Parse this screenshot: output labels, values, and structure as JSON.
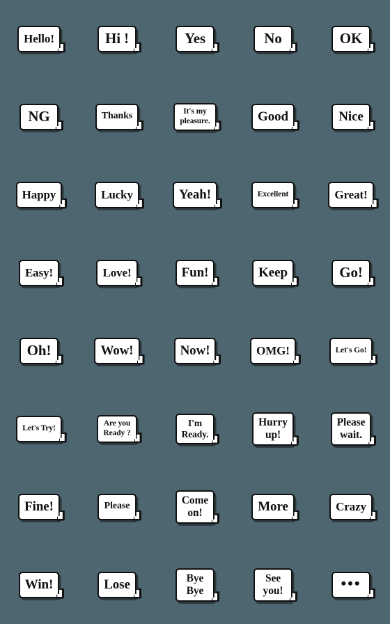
{
  "canvas": {
    "background_color": "#4d6670",
    "bubble_fill": "#ffffff",
    "bubble_border": "#111111",
    "text_color": "#111111",
    "columns": 5,
    "rows": 8
  },
  "stickers": [
    {
      "text": "Hello!",
      "size": "sz-md",
      "lines": 1
    },
    {
      "text": "Hi !",
      "size": "sz-xl",
      "lines": 1
    },
    {
      "text": "Yes",
      "size": "sz-xl",
      "lines": 1
    },
    {
      "text": "No",
      "size": "sz-xl",
      "lines": 1
    },
    {
      "text": "OK",
      "size": "sz-xl",
      "lines": 1
    },
    {
      "text": "NG",
      "size": "sz-xl",
      "lines": 1
    },
    {
      "text": "Thanks",
      "size": "sz-sm",
      "lines": 1
    },
    {
      "text": "It's my\npleasure.",
      "size": "sz-two-sm",
      "lines": 2
    },
    {
      "text": "Good",
      "size": "sz-lg",
      "lines": 1
    },
    {
      "text": "Nice",
      "size": "sz-lg",
      "lines": 1
    },
    {
      "text": "Happy",
      "size": "sz-md",
      "lines": 1
    },
    {
      "text": "Lucky",
      "size": "sz-md",
      "lines": 1
    },
    {
      "text": "Yeah!",
      "size": "sz-lg",
      "lines": 1
    },
    {
      "text": "Excellent",
      "size": "sz-xs",
      "lines": 1
    },
    {
      "text": "Great!",
      "size": "sz-md",
      "lines": 1
    },
    {
      "text": "Easy!",
      "size": "sz-md",
      "lines": 1
    },
    {
      "text": "Love!",
      "size": "sz-md",
      "lines": 1
    },
    {
      "text": "Fun!",
      "size": "sz-lg",
      "lines": 1
    },
    {
      "text": "Keep",
      "size": "sz-lg",
      "lines": 1
    },
    {
      "text": "Go!",
      "size": "sz-xl",
      "lines": 1
    },
    {
      "text": "Oh!",
      "size": "sz-xl",
      "lines": 1
    },
    {
      "text": "Wow!",
      "size": "sz-lg",
      "lines": 1
    },
    {
      "text": "Now!",
      "size": "sz-lg",
      "lines": 1
    },
    {
      "text": "OMG!",
      "size": "sz-md",
      "lines": 1
    },
    {
      "text": "Let's Go!",
      "size": "sz-xs",
      "lines": 1
    },
    {
      "text": "Let's Try!",
      "size": "sz-xs",
      "lines": 1
    },
    {
      "text": "Are you\nReady ?",
      "size": "sz-two-sm",
      "lines": 2
    },
    {
      "text": "I'm\nReady.",
      "size": "sz-two-md",
      "lines": 2
    },
    {
      "text": "Hurry\nup!",
      "size": "sz-two-lg",
      "lines": 2
    },
    {
      "text": "Please\nwait.",
      "size": "sz-two-lg",
      "lines": 2
    },
    {
      "text": "Fine!",
      "size": "sz-lg",
      "lines": 1
    },
    {
      "text": "Please",
      "size": "sz-sm",
      "lines": 1
    },
    {
      "text": "Come\non!",
      "size": "sz-two-lg",
      "lines": 2
    },
    {
      "text": "More",
      "size": "sz-lg",
      "lines": 1
    },
    {
      "text": "Crazy",
      "size": "sz-md",
      "lines": 1
    },
    {
      "text": "Win!",
      "size": "sz-lg",
      "lines": 1
    },
    {
      "text": "Lose",
      "size": "sz-lg",
      "lines": 1
    },
    {
      "text": "Bye\nBye",
      "size": "sz-two-lg",
      "lines": 2
    },
    {
      "text": "See\nyou!",
      "size": "sz-two-lg",
      "lines": 2
    },
    {
      "text": "•••",
      "size": "dots",
      "lines": 1
    }
  ]
}
